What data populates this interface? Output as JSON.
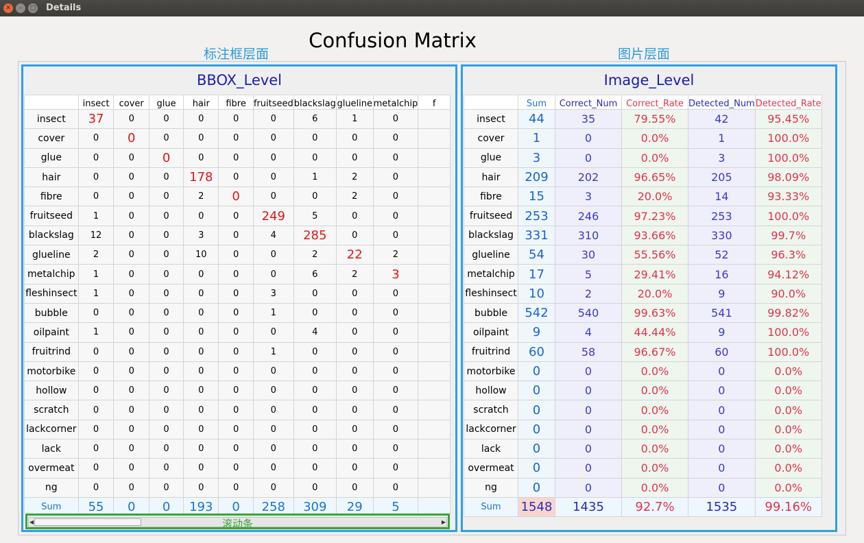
{
  "window": {
    "title": "Details"
  },
  "main_title": "Confusion Matrix",
  "labels": {
    "bbox_cn": "标注框层面",
    "image_cn": "图片层面",
    "scrollbar_cn": "滚动条"
  },
  "bbox_panel": {
    "title": "BBOX_Level",
    "columns": [
      "insect",
      "cover",
      "glue",
      "hair",
      "fibre",
      "fruitseed",
      "blackslag",
      "glueline",
      "metalchip",
      "f"
    ],
    "rows": [
      {
        "label": "insect",
        "values": [
          "37",
          "0",
          "0",
          "0",
          "0",
          "0",
          "6",
          "1",
          "0",
          ""
        ]
      },
      {
        "label": "cover",
        "values": [
          "0",
          "0",
          "0",
          "0",
          "0",
          "0",
          "0",
          "0",
          "0",
          ""
        ]
      },
      {
        "label": "glue",
        "values": [
          "0",
          "0",
          "0",
          "0",
          "0",
          "0",
          "0",
          "0",
          "0",
          ""
        ]
      },
      {
        "label": "hair",
        "values": [
          "0",
          "0",
          "0",
          "178",
          "0",
          "0",
          "1",
          "2",
          "0",
          ""
        ]
      },
      {
        "label": "fibre",
        "values": [
          "0",
          "0",
          "0",
          "2",
          "0",
          "0",
          "0",
          "2",
          "0",
          ""
        ]
      },
      {
        "label": "fruitseed",
        "values": [
          "1",
          "0",
          "0",
          "0",
          "0",
          "249",
          "5",
          "0",
          "0",
          ""
        ]
      },
      {
        "label": "blackslag",
        "values": [
          "12",
          "0",
          "0",
          "3",
          "0",
          "4",
          "285",
          "0",
          "0",
          ""
        ]
      },
      {
        "label": "glueline",
        "values": [
          "2",
          "0",
          "0",
          "10",
          "0",
          "0",
          "2",
          "22",
          "2",
          ""
        ]
      },
      {
        "label": "metalchip",
        "values": [
          "1",
          "0",
          "0",
          "0",
          "0",
          "0",
          "6",
          "2",
          "3",
          ""
        ]
      },
      {
        "label": "fleshinsect",
        "values": [
          "1",
          "0",
          "0",
          "0",
          "0",
          "3",
          "0",
          "0",
          "0",
          ""
        ]
      },
      {
        "label": "bubble",
        "values": [
          "0",
          "0",
          "0",
          "0",
          "0",
          "1",
          "0",
          "0",
          "0",
          ""
        ]
      },
      {
        "label": "oilpaint",
        "values": [
          "1",
          "0",
          "0",
          "0",
          "0",
          "0",
          "4",
          "0",
          "0",
          ""
        ]
      },
      {
        "label": "fruitrind",
        "values": [
          "0",
          "0",
          "0",
          "0",
          "0",
          "1",
          "0",
          "0",
          "0",
          ""
        ]
      },
      {
        "label": "motorbike",
        "values": [
          "0",
          "0",
          "0",
          "0",
          "0",
          "0",
          "0",
          "0",
          "0",
          ""
        ]
      },
      {
        "label": "hollow",
        "values": [
          "0",
          "0",
          "0",
          "0",
          "0",
          "0",
          "0",
          "0",
          "0",
          ""
        ]
      },
      {
        "label": "scratch",
        "values": [
          "0",
          "0",
          "0",
          "0",
          "0",
          "0",
          "0",
          "0",
          "0",
          ""
        ]
      },
      {
        "label": "lackcorner",
        "values": [
          "0",
          "0",
          "0",
          "0",
          "0",
          "0",
          "0",
          "0",
          "0",
          ""
        ]
      },
      {
        "label": "lack",
        "values": [
          "0",
          "0",
          "0",
          "0",
          "0",
          "0",
          "0",
          "0",
          "0",
          ""
        ]
      },
      {
        "label": "overmeat",
        "values": [
          "0",
          "0",
          "0",
          "0",
          "0",
          "0",
          "0",
          "0",
          "0",
          ""
        ]
      },
      {
        "label": "ng",
        "values": [
          "0",
          "0",
          "0",
          "0",
          "0",
          "0",
          "0",
          "0",
          "0",
          ""
        ]
      }
    ],
    "sum_row": {
      "label": "Sum",
      "values": [
        "55",
        "0",
        "0",
        "193",
        "0",
        "258",
        "309",
        "29",
        "5",
        ""
      ]
    }
  },
  "image_panel": {
    "title": "Image_Level",
    "columns": [
      "Sum",
      "Correct_Num",
      "Correct_Rate",
      "Detected_Num",
      "Detected_Rate"
    ],
    "rows": [
      {
        "label": "insect",
        "values": [
          "44",
          "35",
          "79.55%",
          "42",
          "95.45%"
        ]
      },
      {
        "label": "cover",
        "values": [
          "1",
          "0",
          "0.0%",
          "1",
          "100.0%"
        ]
      },
      {
        "label": "glue",
        "values": [
          "3",
          "0",
          "0.0%",
          "3",
          "100.0%"
        ]
      },
      {
        "label": "hair",
        "values": [
          "209",
          "202",
          "96.65%",
          "205",
          "98.09%"
        ]
      },
      {
        "label": "fibre",
        "values": [
          "15",
          "3",
          "20.0%",
          "14",
          "93.33%"
        ]
      },
      {
        "label": "fruitseed",
        "values": [
          "253",
          "246",
          "97.23%",
          "253",
          "100.0%"
        ]
      },
      {
        "label": "blackslag",
        "values": [
          "331",
          "310",
          "93.66%",
          "330",
          "99.7%"
        ]
      },
      {
        "label": "glueline",
        "values": [
          "54",
          "30",
          "55.56%",
          "52",
          "96.3%"
        ]
      },
      {
        "label": "metalchip",
        "values": [
          "17",
          "5",
          "29.41%",
          "16",
          "94.12%"
        ]
      },
      {
        "label": "fleshinsect",
        "values": [
          "10",
          "2",
          "20.0%",
          "9",
          "90.0%"
        ]
      },
      {
        "label": "bubble",
        "values": [
          "542",
          "540",
          "99.63%",
          "541",
          "99.82%"
        ]
      },
      {
        "label": "oilpaint",
        "values": [
          "9",
          "4",
          "44.44%",
          "9",
          "100.0%"
        ]
      },
      {
        "label": "fruitrind",
        "values": [
          "60",
          "58",
          "96.67%",
          "60",
          "100.0%"
        ]
      },
      {
        "label": "motorbike",
        "values": [
          "0",
          "0",
          "0.0%",
          "0",
          "0.0%"
        ]
      },
      {
        "label": "hollow",
        "values": [
          "0",
          "0",
          "0.0%",
          "0",
          "0.0%"
        ]
      },
      {
        "label": "scratch",
        "values": [
          "0",
          "0",
          "0.0%",
          "0",
          "0.0%"
        ]
      },
      {
        "label": "lackcorner",
        "values": [
          "0",
          "0",
          "0.0%",
          "0",
          "0.0%"
        ]
      },
      {
        "label": "lack",
        "values": [
          "0",
          "0",
          "0.0%",
          "0",
          "0.0%"
        ]
      },
      {
        "label": "overmeat",
        "values": [
          "0",
          "0",
          "0.0%",
          "0",
          "0.0%"
        ]
      },
      {
        "label": "ng",
        "values": [
          "0",
          "0",
          "0.0%",
          "0",
          "0.0%"
        ]
      }
    ],
    "sum_row": {
      "label": "Sum",
      "values": [
        "1548",
        "1435",
        "92.7%",
        "1535",
        "99.16%"
      ]
    }
  },
  "scrollbar": {
    "position_fraction": 0.0,
    "visible_fraction": 0.27
  }
}
